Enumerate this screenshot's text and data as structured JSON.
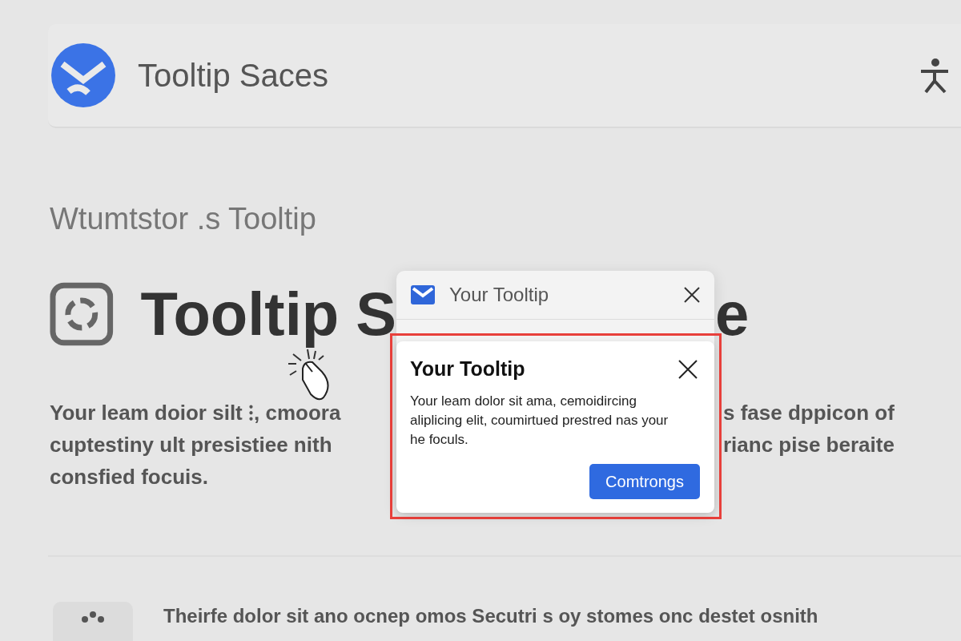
{
  "app_header": {
    "title": "Tooltip Saces"
  },
  "section_label": "Wtumtstor .s Tooltip",
  "heading": {
    "visible_start": "Tooltip S",
    "visible_end": "e"
  },
  "intro": {
    "left_lines": [
      "Your leam doior silt ⁝, cmoora",
      "cuptestiny ult presistiee nith",
      "consfied focuis."
    ],
    "right_lines": [
      "s fase dppicon of",
      "rianc pise beraite"
    ]
  },
  "bottom_card": {
    "text": "Theirfe dolor sit ano ocnep omos Secutri s oy stomes onc destet osnith"
  },
  "back_popup": {
    "title": "Your Tooltip"
  },
  "tooltip": {
    "title": "Your Tooltip",
    "body": "Your leam dolor sit ama, cemoidircing aliplicing elit, coumirtued prestred nas your he foculs.",
    "button": "Comtrongs",
    "highlighted": true
  }
}
